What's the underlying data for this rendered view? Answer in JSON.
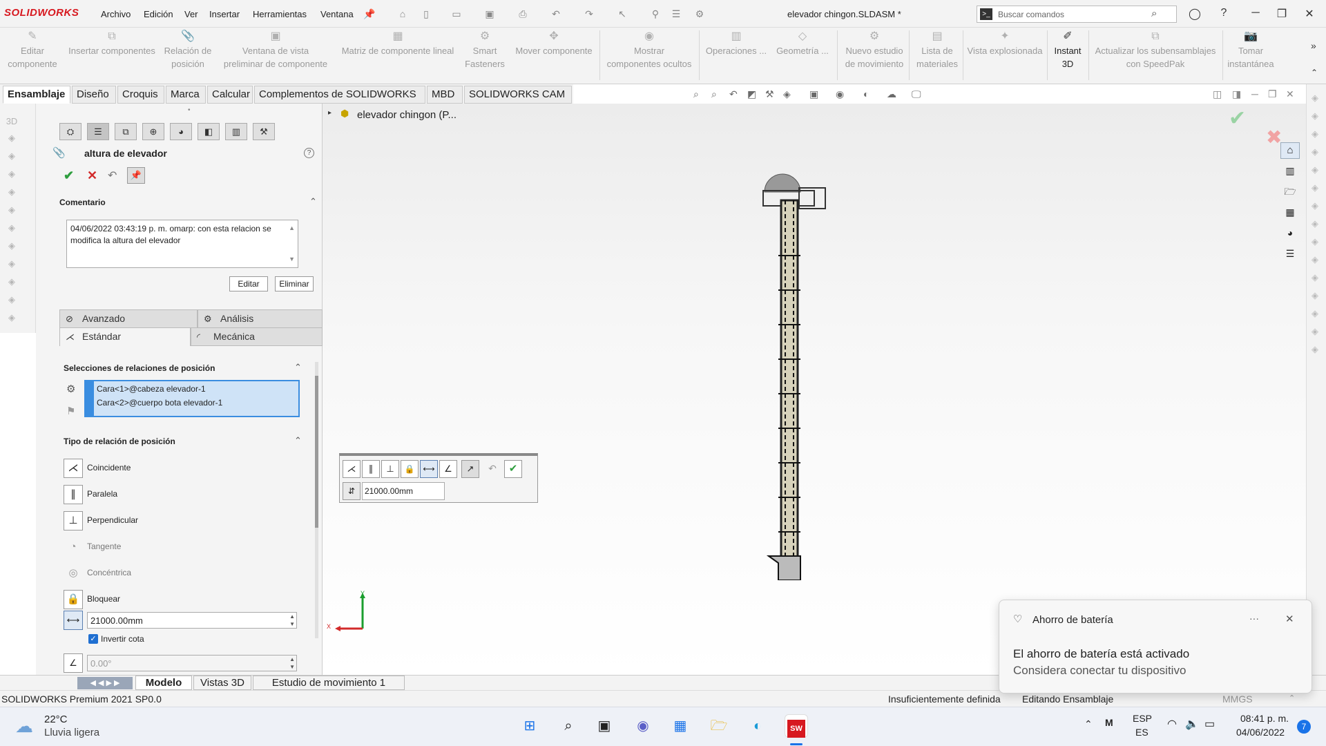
{
  "app": {
    "logo_text": "SOLIDWORKS",
    "document_title": "elevador chingon.SLDASM *"
  },
  "menu": [
    "Archivo",
    "Edición",
    "Ver",
    "Insertar",
    "Herramientas",
    "Ventana"
  ],
  "search": {
    "placeholder": "Buscar comandos"
  },
  "commands": [
    {
      "label": "Editar\ncomponente",
      "icon": "edit-component-icon"
    },
    {
      "label": "Insertar componentes",
      "icon": "insert-components-icon"
    },
    {
      "label": "Relación de\nposición",
      "icon": "mate-icon"
    },
    {
      "label": "Ventana de vista\npreliminar de componente",
      "icon": "preview-window-icon"
    },
    {
      "label": "Matriz de componente lineal",
      "icon": "linear-pattern-icon"
    },
    {
      "label": "Smart\nFasteners",
      "icon": "smart-fasteners-icon"
    },
    {
      "label": "Mover componente",
      "icon": "move-component-icon"
    },
    {
      "label": "Mostrar\ncomponentes ocultos",
      "icon": "show-hidden-icon"
    },
    {
      "label": "Operaciones ...",
      "icon": "features-icon"
    },
    {
      "label": "Geometría ...",
      "icon": "geometry-icon"
    },
    {
      "label": "Nuevo estudio\nde movimiento",
      "icon": "motion-study-icon"
    },
    {
      "label": "Lista de\nmateriales",
      "icon": "bom-icon"
    },
    {
      "label": "Vista explosionada",
      "icon": "exploded-view-icon"
    },
    {
      "label": "Instant\n3D",
      "icon": "instant3d-icon"
    },
    {
      "label": "Actualizar los subensamblajes\ncon SpeedPak",
      "icon": "speedpak-icon"
    },
    {
      "label": "Tomar\ninstantánea",
      "icon": "snapshot-icon"
    }
  ],
  "tabs": [
    "Ensamblaje",
    "Diseño",
    "Croquis",
    "Marca",
    "Calcular",
    "Complementos de SOLIDWORKS",
    "MBD",
    "SOLIDWORKS CAM"
  ],
  "tree": {
    "root": "elevador chingon  (P..."
  },
  "property_manager": {
    "title": "altura de elevador",
    "comment_header": "Comentario",
    "comment_text": "04/06/2022 03:43:19 p. m. omarp:  con esta relacion se modifica la altura del elevador",
    "edit_button": "Editar",
    "delete_button": "Eliminar",
    "subtabs": {
      "advanced": "Avanzado",
      "analysis": "Análisis",
      "standard": "Estándar",
      "mechanical": "Mecánica"
    },
    "selections_header": "Selecciones de relaciones de posición",
    "selections": [
      "Cara<1>@cabeza elevador-1",
      "Cara<2>@cuerpo bota elevador-1"
    ],
    "type_header": "Tipo de relación de posición",
    "types": [
      {
        "label": "Coincidente",
        "icon": "coincident-icon",
        "enabled": true
      },
      {
        "label": "Paralela",
        "icon": "parallel-icon",
        "enabled": true
      },
      {
        "label": "Perpendicular",
        "icon": "perpendicular-icon",
        "enabled": true
      },
      {
        "label": "Tangente",
        "icon": "tangent-icon",
        "enabled": false
      },
      {
        "label": "Concéntrica",
        "icon": "concentric-icon",
        "enabled": false
      },
      {
        "label": "Bloquear",
        "icon": "lock-icon",
        "enabled": true
      }
    ],
    "distance_value": "21000.00mm",
    "flip_dimension_label": "Invertir cota",
    "flip_dimension_checked": true,
    "angle_value": "0.00°"
  },
  "popup_toolbar": {
    "distance_value": "21000.00mm"
  },
  "axis": {
    "x": "X",
    "y": "Y"
  },
  "bottom_tabs": [
    "Modelo",
    "Vistas 3D",
    "Estudio de movimiento 1"
  ],
  "status": {
    "left": "SOLIDWORKS Premium 2021 SP0.0",
    "definition": "Insuficientemente definida",
    "mode": "Editando Ensamblaje",
    "units": "MMGS"
  },
  "weather": {
    "temp": "22°C",
    "desc": "Lluvia ligera"
  },
  "tray": {
    "lang1": "ESP",
    "lang2": "ES",
    "time": "08:41 p. m.",
    "date": "04/06/2022",
    "notif_count": "7"
  },
  "toast": {
    "app": "Ahorro de batería",
    "title": "El ahorro de batería está activado",
    "body": "Considera conectar tu dispositivo"
  },
  "colors": {
    "brand_red": "#d71920",
    "selection_blue": "#cfe3f7",
    "accept_green": "#2e9e3e",
    "cancel_red": "#d22a2a"
  }
}
